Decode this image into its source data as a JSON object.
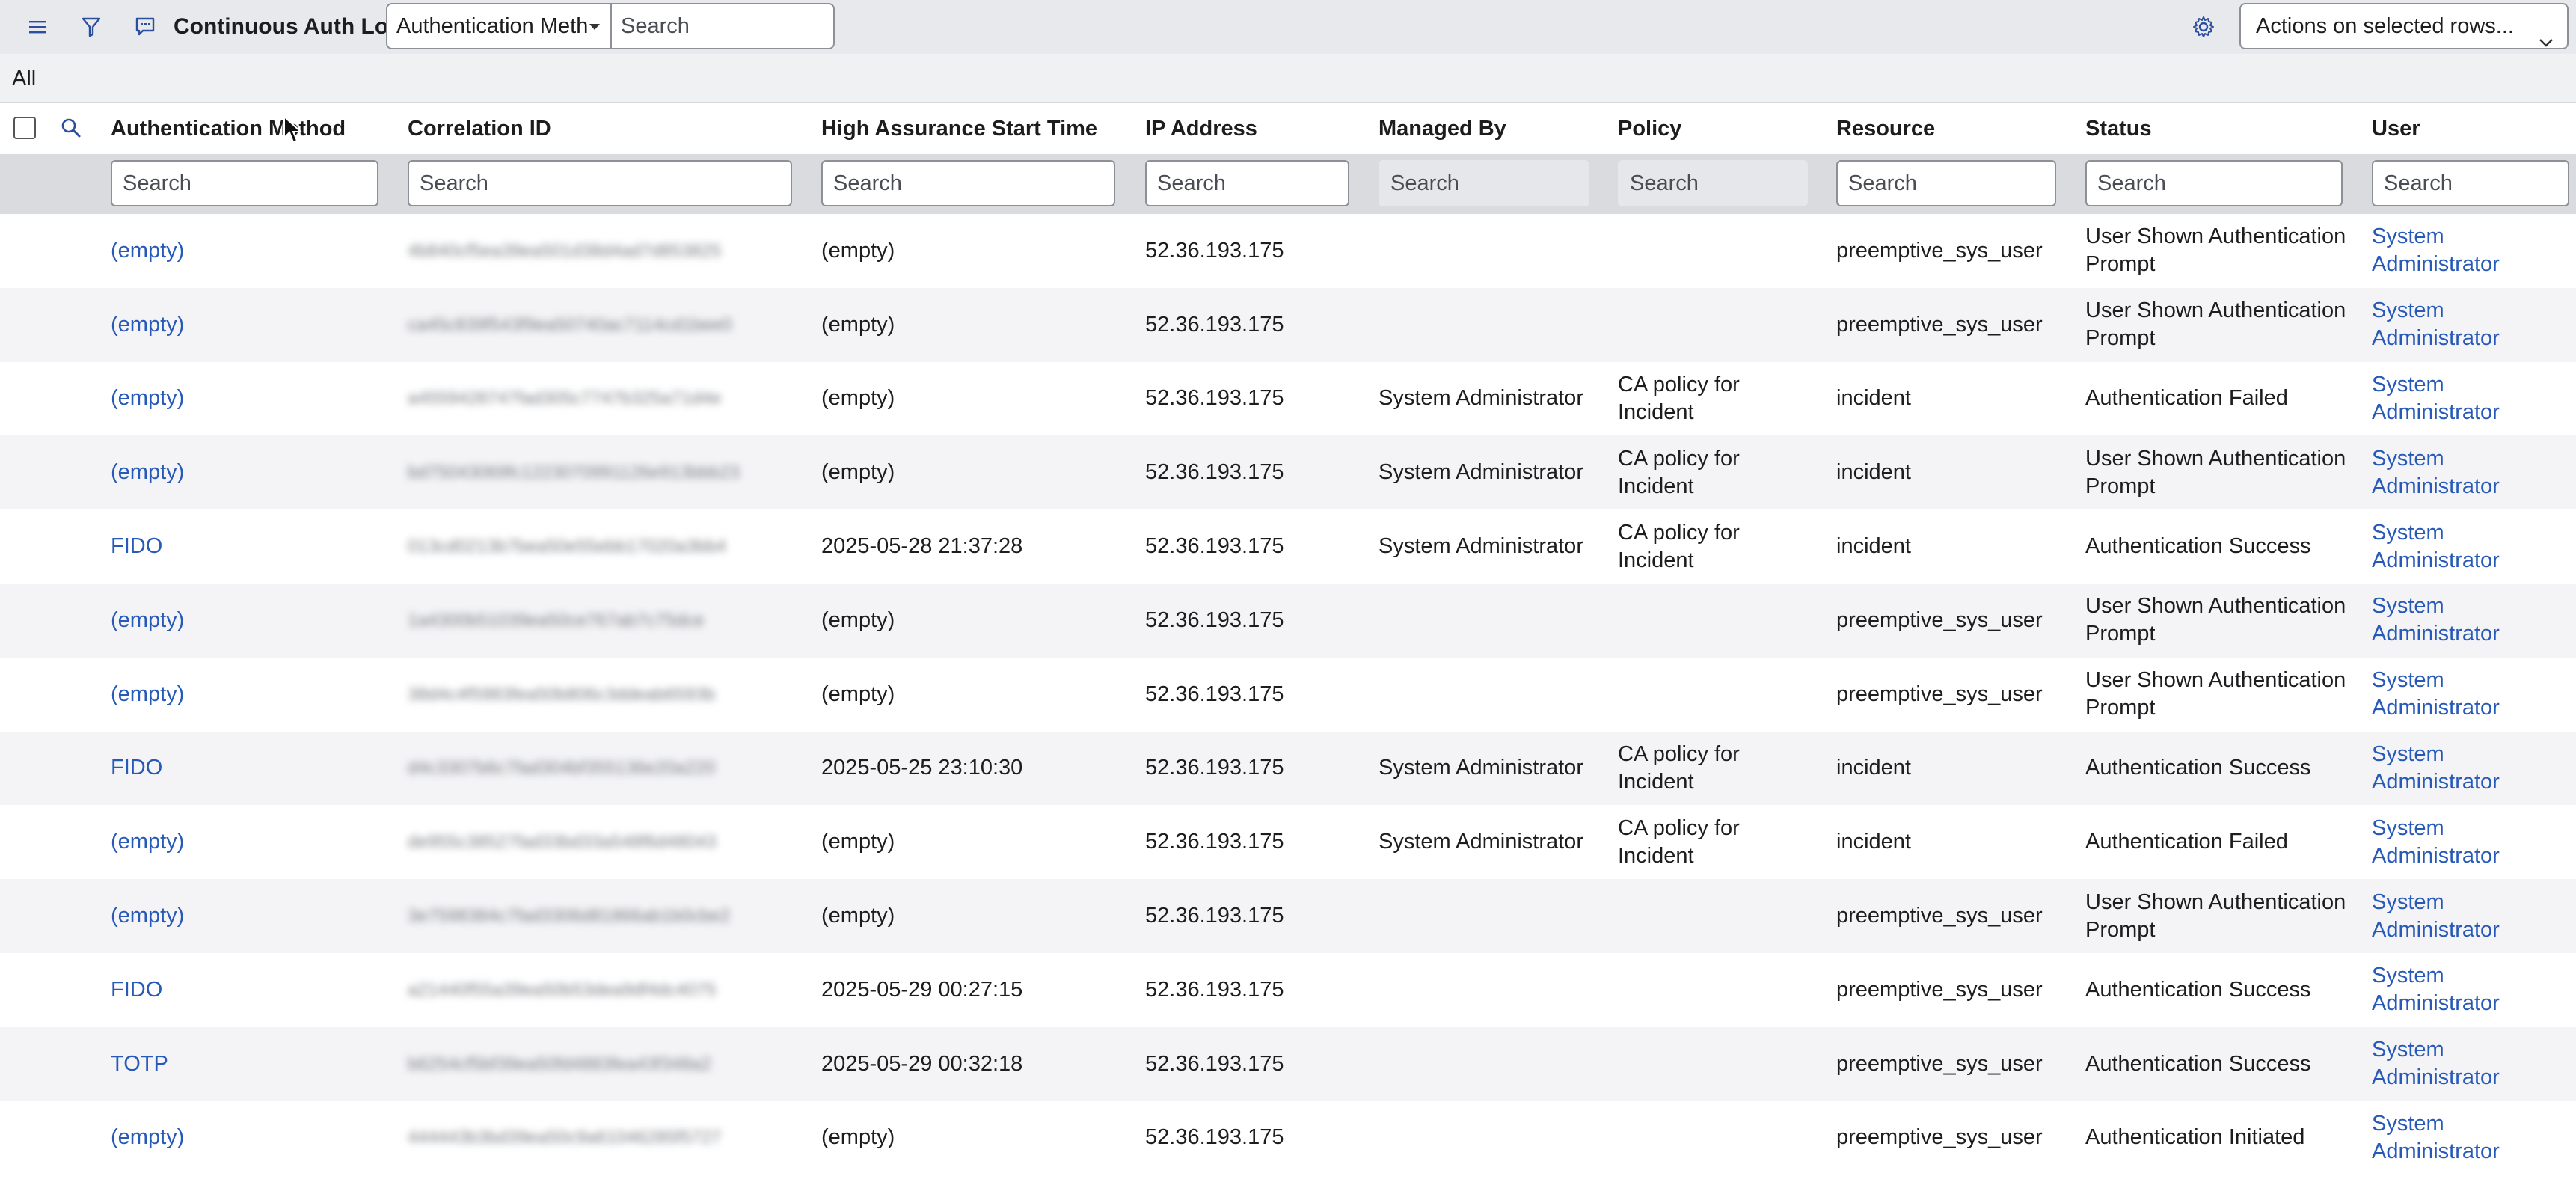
{
  "header": {
    "title": "Continuous Auth Logs",
    "field_select_value": "Authentication Meth",
    "search_placeholder": "Search",
    "actions_label": "Actions on selected rows..."
  },
  "breadcrumb": "All",
  "columns": [
    {
      "key": "auth_method",
      "label": "Authentication Method"
    },
    {
      "key": "correlation_id",
      "label": "Correlation ID"
    },
    {
      "key": "ha_start",
      "label": "High Assurance Start Time"
    },
    {
      "key": "ip",
      "label": "IP Address"
    },
    {
      "key": "managed_by",
      "label": "Managed By"
    },
    {
      "key": "policy",
      "label": "Policy"
    },
    {
      "key": "resource",
      "label": "Resource"
    },
    {
      "key": "status",
      "label": "Status"
    },
    {
      "key": "user",
      "label": "User"
    }
  ],
  "column_search_placeholder": "Search",
  "rows": [
    {
      "auth_method": "(empty)",
      "correlation_id": "4b840cf5ea39ea501d38d4ad7d853825",
      "ha_start": "(empty)",
      "ip": "52.36.193.175",
      "managed_by": "",
      "policy": "",
      "resource": "preemptive_sys_user",
      "status": "User Shown Authentication Prompt",
      "user": "System Administrator"
    },
    {
      "auth_method": "(empty)",
      "correlation_id": "ca45c839f543f9ea50740ac7114cd1bee0",
      "ha_start": "(empty)",
      "ip": "52.36.193.175",
      "managed_by": "",
      "policy": "",
      "resource": "preemptive_sys_user",
      "status": "User Shown Authentication Prompt",
      "user": "System Administrator"
    },
    {
      "auth_method": "(empty)",
      "correlation_id": "a4559428747fad305c7747b325a71d4e",
      "ha_start": "(empty)",
      "ip": "52.36.193.175",
      "managed_by": "System Administrator",
      "policy": "CA policy for Incident",
      "resource": "incident",
      "status": "Authentication Failed",
      "user": "System Administrator"
    },
    {
      "auth_method": "(empty)",
      "correlation_id": "bd75043069fc1223070991126e913bbb23",
      "ha_start": "(empty)",
      "ip": "52.36.193.175",
      "managed_by": "System Administrator",
      "policy": "CA policy for Incident",
      "resource": "incident",
      "status": "User Shown Authentication Prompt",
      "user": "System Administrator"
    },
    {
      "auth_method": "FIDO",
      "correlation_id": "013cd0213b7bea50e55ebb17020a3bb4",
      "ha_start": "2025-05-28 21:37:28",
      "ip": "52.36.193.175",
      "managed_by": "System Administrator",
      "policy": "CA policy for Incident",
      "resource": "incident",
      "status": "Authentication Success",
      "user": "System Administrator"
    },
    {
      "auth_method": "(empty)",
      "correlation_id": "1a4300b51039ea50ce767ab7c75dce",
      "ha_start": "(empty)",
      "ip": "52.36.193.175",
      "managed_by": "",
      "policy": "",
      "resource": "preemptive_sys_user",
      "status": "User Shown Authentication Prompt",
      "user": "System Administrator"
    },
    {
      "auth_method": "(empty)",
      "correlation_id": "38d4c4f5983fea50b806c3ddeab6593b",
      "ha_start": "(empty)",
      "ip": "52.36.193.175",
      "managed_by": "",
      "policy": "",
      "resource": "preemptive_sys_user",
      "status": "User Shown Authentication Prompt",
      "user": "System Administrator"
    },
    {
      "auth_method": "FIDO",
      "correlation_id": "d4c3307b6c7fad304bf355136e20a220",
      "ha_start": "2025-05-25 23:10:30",
      "ip": "52.36.193.175",
      "managed_by": "System Administrator",
      "policy": "CA policy for Incident",
      "resource": "incident",
      "status": "Authentication Success",
      "user": "System Administrator"
    },
    {
      "auth_method": "(empty)",
      "correlation_id": "de955c38527fad33bd33a548f6d48043",
      "ha_start": "(empty)",
      "ip": "52.36.193.175",
      "managed_by": "System Administrator",
      "policy": "CA policy for Incident",
      "resource": "incident",
      "status": "Authentication Failed",
      "user": "System Administrator"
    },
    {
      "auth_method": "(empty)",
      "correlation_id": "3e7598384c7fad3306d81866ab1b0cbe2",
      "ha_start": "(empty)",
      "ip": "52.36.193.175",
      "managed_by": "",
      "policy": "",
      "resource": "preemptive_sys_user",
      "status": "User Shown Authentication Prompt",
      "user": "System Administrator"
    },
    {
      "auth_method": "FIDO",
      "correlation_id": "a21440f55a39ea50b53dea9df4dc4075",
      "ha_start": "2025-05-29 00:27:15",
      "ip": "52.36.193.175",
      "managed_by": "",
      "policy": "",
      "resource": "preemptive_sys_user",
      "status": "Authentication Success",
      "user": "System Administrator"
    },
    {
      "auth_method": "TOTP",
      "correlation_id": "b6254cf5bf39ea50fd4883fea43f348a2",
      "ha_start": "2025-05-29 00:32:18",
      "ip": "52.36.193.175",
      "managed_by": "",
      "policy": "",
      "resource": "preemptive_sys_user",
      "status": "Authentication Success",
      "user": "System Administrator"
    },
    {
      "auth_method": "(empty)",
      "correlation_id": "444443b3bd39ea50c9a61046285f5727",
      "ha_start": "(empty)",
      "ip": "52.36.193.175",
      "managed_by": "",
      "policy": "",
      "resource": "preemptive_sys_user",
      "status": "Authentication Initiated",
      "user": "System Administrator"
    }
  ],
  "icons": {
    "menu": "menu-icon",
    "filter": "filter-icon",
    "chat": "chat-icon",
    "settings": "gear-icon",
    "search": "search-icon"
  },
  "colors": {
    "link": "#2659b8",
    "header_bg": "#e8e9ec",
    "filter_bg": "#d9dbdf",
    "alt_row": "#f4f4f6"
  }
}
